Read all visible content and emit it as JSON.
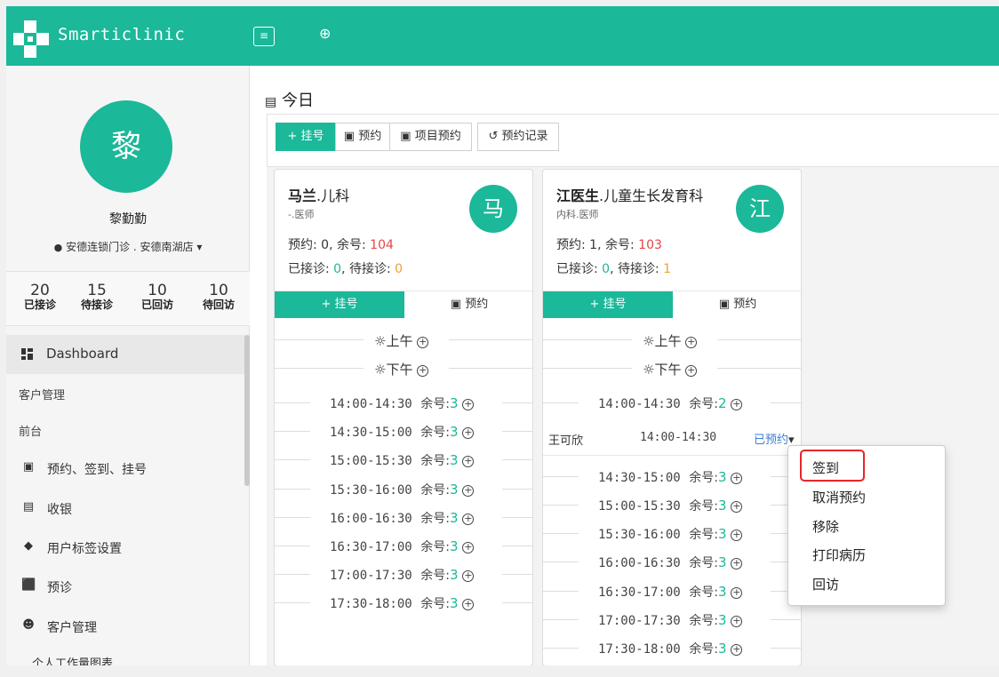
{
  "app": {
    "brand": "Smarticlinic",
    "menu_icon": "≡",
    "plus_icon": "⊕"
  },
  "page": {
    "title": "今日",
    "title_icon": "📰"
  },
  "profile": {
    "avatar_char": "黎",
    "name": "黎勤勤",
    "clinic": "安德连锁门诊 . 安德南湖店",
    "clinic_caret": "▾"
  },
  "stats": [
    {
      "value": "20",
      "label": "已接诊"
    },
    {
      "value": "15",
      "label": "待接诊"
    },
    {
      "value": "10",
      "label": "已回访"
    },
    {
      "value": "10",
      "label": "待回访"
    }
  ],
  "nav": {
    "dashboard": "Dashboard",
    "section1": "客户管理",
    "section2": "前台",
    "items": [
      {
        "label": "预约、签到、挂号"
      },
      {
        "label": "收银"
      },
      {
        "label": "用户标签设置"
      },
      {
        "label": "预诊"
      },
      {
        "label": "客户管理"
      }
    ],
    "sub_item": "个人工作量图表"
  },
  "toolbar": {
    "register": "+ 挂号",
    "appointment": "预约",
    "project_appointment": "项目预约",
    "appointment_history": "预约记录"
  },
  "doctors": [
    {
      "name_bold": "马兰",
      "dept": ".儿科",
      "title": "-.医师",
      "avatar": "马",
      "reserved_label": "预约:",
      "reserved": "0",
      "remain_label": ", 余号:",
      "remain": "104",
      "received_label": "已接诊:",
      "received": "0",
      "waiting_label": ", 待接诊:",
      "waiting": "0",
      "tab_register": "+ 挂号",
      "tab_appointment": "预约",
      "morning": "上午",
      "afternoon": "下午",
      "slots": [
        {
          "time": "14:00-14:30",
          "remain_label": "余号:",
          "remain": "3"
        },
        {
          "time": "14:30-15:00",
          "remain_label": "余号:",
          "remain": "3"
        },
        {
          "time": "15:00-15:30",
          "remain_label": "余号:",
          "remain": "3"
        },
        {
          "time": "15:30-16:00",
          "remain_label": "余号:",
          "remain": "3"
        },
        {
          "time": "16:00-16:30",
          "remain_label": "余号:",
          "remain": "3"
        },
        {
          "time": "16:30-17:00",
          "remain_label": "余号:",
          "remain": "3"
        },
        {
          "time": "17:00-17:30",
          "remain_label": "余号:",
          "remain": "3"
        },
        {
          "time": "17:30-18:00",
          "remain_label": "余号:",
          "remain": "3"
        }
      ]
    },
    {
      "name_bold": "江医生",
      "dept": ".儿童生长发育科",
      "title": "内科.医师",
      "avatar": "江",
      "reserved_label": "预约:",
      "reserved": "1",
      "remain_label": ", 余号:",
      "remain": "103",
      "received_label": "已接诊:",
      "received": "0",
      "waiting_label": ", 待接诊:",
      "waiting": "1",
      "tab_register": "+ 挂号",
      "tab_appointment": "预约",
      "morning": "上午",
      "afternoon": "下午",
      "first_slot": {
        "time": "14:00-14:30",
        "remain_label": "余号:",
        "remain": "2"
      },
      "appointment": {
        "patient": "王可欣",
        "time": "14:00-14:30",
        "status": "已预约",
        "caret": "▾"
      },
      "slots": [
        {
          "time": "14:30-15:00",
          "remain_label": "余号:",
          "remain": "3"
        },
        {
          "time": "15:00-15:30",
          "remain_label": "余号:",
          "remain": "3"
        },
        {
          "time": "15:30-16:00",
          "remain_label": "余号:",
          "remain": "3"
        },
        {
          "time": "16:00-16:30",
          "remain_label": "余号:",
          "remain": "3"
        },
        {
          "time": "16:30-17:00",
          "remain_label": "余号:",
          "remain": "3"
        },
        {
          "time": "17:00-17:30",
          "remain_label": "余号:",
          "remain": "3"
        },
        {
          "time": "17:30-18:00",
          "remain_label": "余号:",
          "remain": "3"
        }
      ]
    }
  ],
  "dropdown": {
    "items": [
      "签到",
      "取消预约",
      "移除",
      "打印病历",
      "回访"
    ],
    "highlighted": "签到",
    "highlight_color": "#e8242a"
  },
  "colors": {
    "accent": "#1bb899",
    "remain_red": "#e64545",
    "waiting_orange": "#f0a030"
  }
}
